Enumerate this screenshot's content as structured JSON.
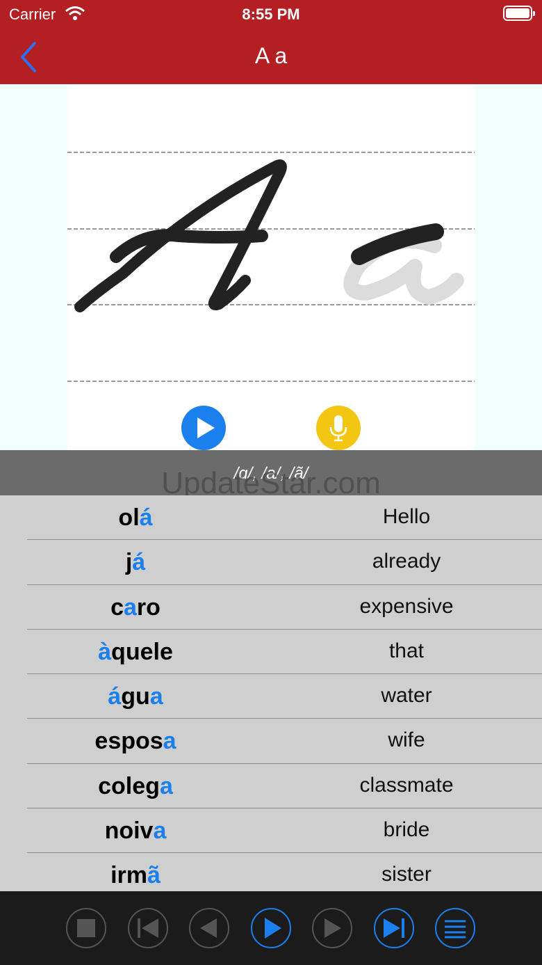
{
  "status_bar": {
    "carrier": "Carrier",
    "time": "8:55 PM"
  },
  "nav": {
    "title": "A a"
  },
  "phonetic": "/ɑ/, /a/, /ã/",
  "watermark": "UpdateStar.com",
  "words": [
    {
      "pre": "ol",
      "hl": "á",
      "post": "",
      "hl2": "",
      "translation": "Hello"
    },
    {
      "pre": "j",
      "hl": "á",
      "post": "",
      "hl2": "",
      "translation": "already"
    },
    {
      "pre": "c",
      "hl": "a",
      "post": "ro",
      "hl2": "",
      "translation": "expensive"
    },
    {
      "pre": "",
      "hl": "à",
      "post": "quele",
      "hl2": "",
      "translation": "that"
    },
    {
      "pre": "",
      "hl": "á",
      "post": "gu",
      "hl2": "a",
      "translation": "water"
    },
    {
      "pre": "espos",
      "hl": "a",
      "post": "",
      "hl2": "",
      "translation": "wife"
    },
    {
      "pre": "coleg",
      "hl": "a",
      "post": "",
      "hl2": "",
      "translation": "classmate"
    },
    {
      "pre": "noiv",
      "hl": "a",
      "post": "",
      "hl2": "",
      "translation": "bride"
    },
    {
      "pre": "irm",
      "hl": "ã",
      "post": "",
      "hl2": "",
      "translation": "sister"
    }
  ],
  "colors": {
    "header": "#b31f22",
    "accent": "#1b7fee",
    "mic": "#f2c613"
  },
  "icons": [
    "back-chevron-icon",
    "play-icon",
    "microphone-icon",
    "stop-icon",
    "skip-back-icon",
    "rewind-icon",
    "play-icon",
    "fast-forward-icon",
    "skip-forward-icon",
    "list-icon"
  ]
}
